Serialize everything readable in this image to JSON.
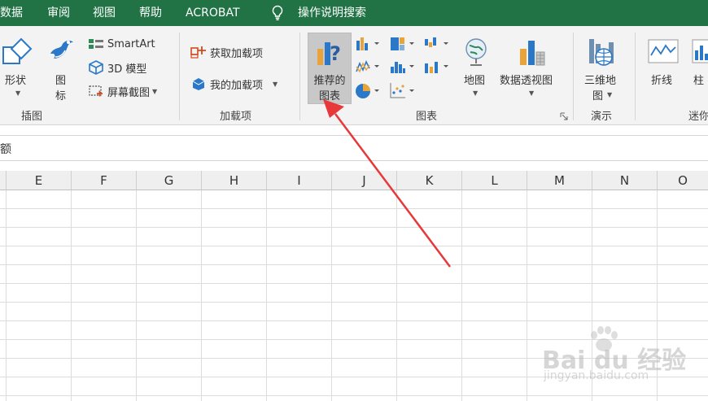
{
  "menu": {
    "items": [
      "数据",
      "审阅",
      "视图",
      "帮助",
      "ACROBAT"
    ],
    "tell_me": "操作说明搜索"
  },
  "ribbon": {
    "insert_group": {
      "shapes": "形状",
      "icons_line1": "图",
      "icons_line2": "标",
      "smartart": "SmartArt",
      "model3d": "3D 模型",
      "screenshot": "屏幕截图",
      "label": "插图"
    },
    "addins_group": {
      "get_addins": "获取加载项",
      "my_addins": "我的加载项",
      "label": "加载项"
    },
    "charts_group": {
      "recommended_line1": "推荐的",
      "recommended_line2": "图表",
      "maps": "地图",
      "pivot_chart": "数据透视图",
      "label": "图表"
    },
    "tours_group": {
      "map3d_line1": "三维地",
      "map3d_line2": "图",
      "label": "演示"
    },
    "sparklines_group": {
      "line": "折线",
      "column": "柱",
      "label": "迷你"
    }
  },
  "formula_bar": {
    "text": "额"
  },
  "columns": [
    "E",
    "F",
    "G",
    "H",
    "I",
    "J",
    "K",
    "L",
    "M",
    "N",
    "O"
  ],
  "watermark": {
    "brand": "Bai du 经验",
    "url": "jingyan.baidu.com"
  },
  "colors": {
    "menu_bg": "#217346",
    "arrow": "#e8393a",
    "selected_button": "#c8c8c8"
  }
}
